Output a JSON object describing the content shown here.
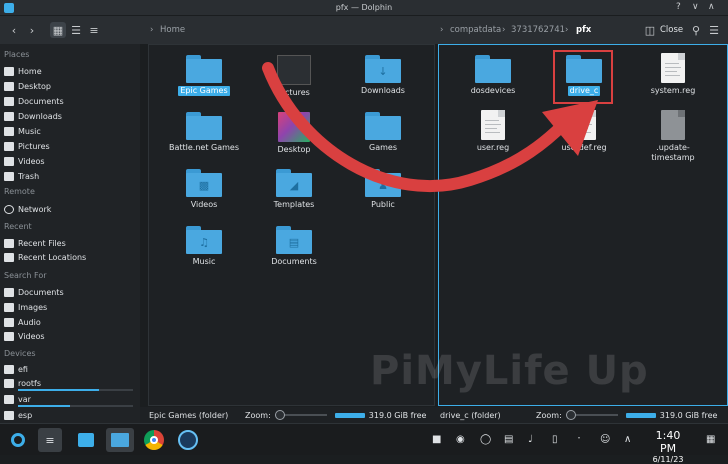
{
  "window": {
    "title": "pfx — Dolphin"
  },
  "toolbar": {
    "left_crumb": "Home",
    "right_crumbs": [
      "compatdata",
      "3731762741",
      "pfx"
    ],
    "close_label": "Close"
  },
  "sidebar": {
    "places_header": "Places",
    "places": [
      "Home",
      "Desktop",
      "Documents",
      "Downloads",
      "Music",
      "Pictures",
      "Videos",
      "Trash"
    ],
    "remote_header": "Remote",
    "remote": [
      "Network"
    ],
    "recent_header": "Recent",
    "recent": [
      "Recent Files",
      "Recent Locations"
    ],
    "search_header": "Search For",
    "search": [
      "Documents",
      "Images",
      "Audio",
      "Videos"
    ],
    "devices_header": "Devices",
    "devices": [
      {
        "label": "efi",
        "usage": 0
      },
      {
        "label": "rootfs",
        "usage": 0.7
      },
      {
        "label": "var",
        "usage": 0.45
      },
      {
        "label": "esp",
        "usage": 0
      }
    ]
  },
  "left_pane": {
    "items": [
      "Epic Games",
      "Pictures",
      "Downloads",
      "Battle.net Games",
      "Desktop",
      "Games",
      "Videos",
      "Templates",
      "Public",
      "Music",
      "Documents"
    ],
    "selected": "Epic Games"
  },
  "right_pane": {
    "items": [
      "dosdevices",
      "drive_c",
      "system.reg",
      "user.reg",
      "userdef.reg",
      ".update-timestamp"
    ],
    "selected": "drive_c"
  },
  "status_left": {
    "text": "Epic Games (folder)",
    "zoom_label": "Zoom:",
    "free": "319.0 GiB free"
  },
  "status_right": {
    "text": "drive_c (folder)",
    "zoom_label": "Zoom:",
    "free": "319.0 GiB free"
  },
  "taskbar": {
    "time": "1:40 PM",
    "date": "6/11/23"
  },
  "watermark": "PiMyLife Up",
  "colors": {
    "accent": "#3daee9",
    "highlight_box": "#d94040",
    "arrow": "#d94040"
  }
}
